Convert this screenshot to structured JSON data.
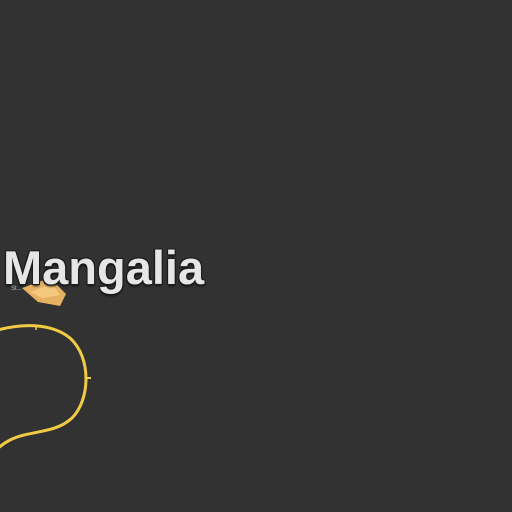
{
  "map": {
    "background": "#323232",
    "city_label": "Mangalia",
    "small_label": "St...",
    "road_color": "#f2cb45",
    "poi_color": "#f0b866",
    "poi_icon": "building-icon"
  }
}
